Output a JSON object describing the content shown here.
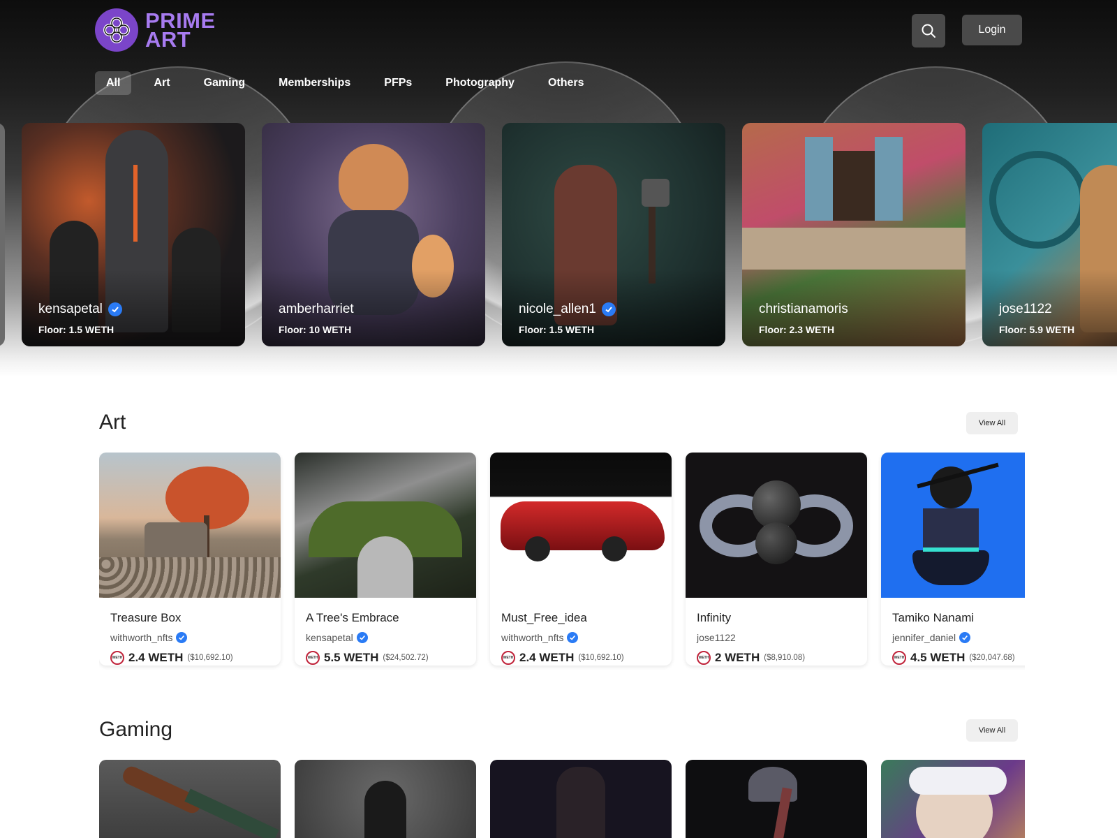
{
  "brand": {
    "name_line1": "PRIME",
    "name_line2": "ART"
  },
  "header": {
    "login_label": "Login"
  },
  "nav": {
    "tabs": [
      "All",
      "Art",
      "Gaming",
      "Memberships",
      "PFPs",
      "Photography",
      "Others"
    ],
    "active": "All"
  },
  "hero": {
    "collections": [
      {
        "name": "kensapetal",
        "verified": true,
        "floor": "Floor: 1.5 WETH"
      },
      {
        "name": "amberharriet",
        "verified": false,
        "floor": "Floor: 10 WETH"
      },
      {
        "name": "nicole_allen1",
        "verified": true,
        "floor": "Floor: 1.5 WETH"
      },
      {
        "name": "christianamoris",
        "verified": false,
        "floor": "Floor: 2.3 WETH"
      },
      {
        "name": "jose1122",
        "verified": false,
        "floor": "Floor: 5.9 WETH"
      }
    ]
  },
  "sections": {
    "art": {
      "title": "Art",
      "view_all": "View All",
      "items": [
        {
          "title": "Treasure Box",
          "creator": "withworth_nfts",
          "verified": true,
          "price": "2.4 WETH",
          "usd": "($10,692.10)"
        },
        {
          "title": "A Tree's Embrace",
          "creator": "kensapetal",
          "verified": true,
          "price": "5.5 WETH",
          "usd": "($24,502.72)"
        },
        {
          "title": "Must_Free_idea",
          "creator": "withworth_nfts",
          "verified": true,
          "price": "2.4 WETH",
          "usd": "($10,692.10)"
        },
        {
          "title": "Infinity",
          "creator": "jose1122",
          "verified": false,
          "price": "2 WETH",
          "usd": "($8,910.08)"
        },
        {
          "title": "Tamiko Nanami",
          "creator": "jennifer_daniel",
          "verified": true,
          "price": "4.5 WETH",
          "usd": "($20,047.68)"
        }
      ]
    },
    "gaming": {
      "title": "Gaming",
      "view_all": "View All"
    }
  },
  "weth_icon_text": "WETH",
  "colors": {
    "brand_purple": "#7b45c9",
    "verified_blue": "#2a7bf5",
    "weth_red": "#c0233a"
  }
}
